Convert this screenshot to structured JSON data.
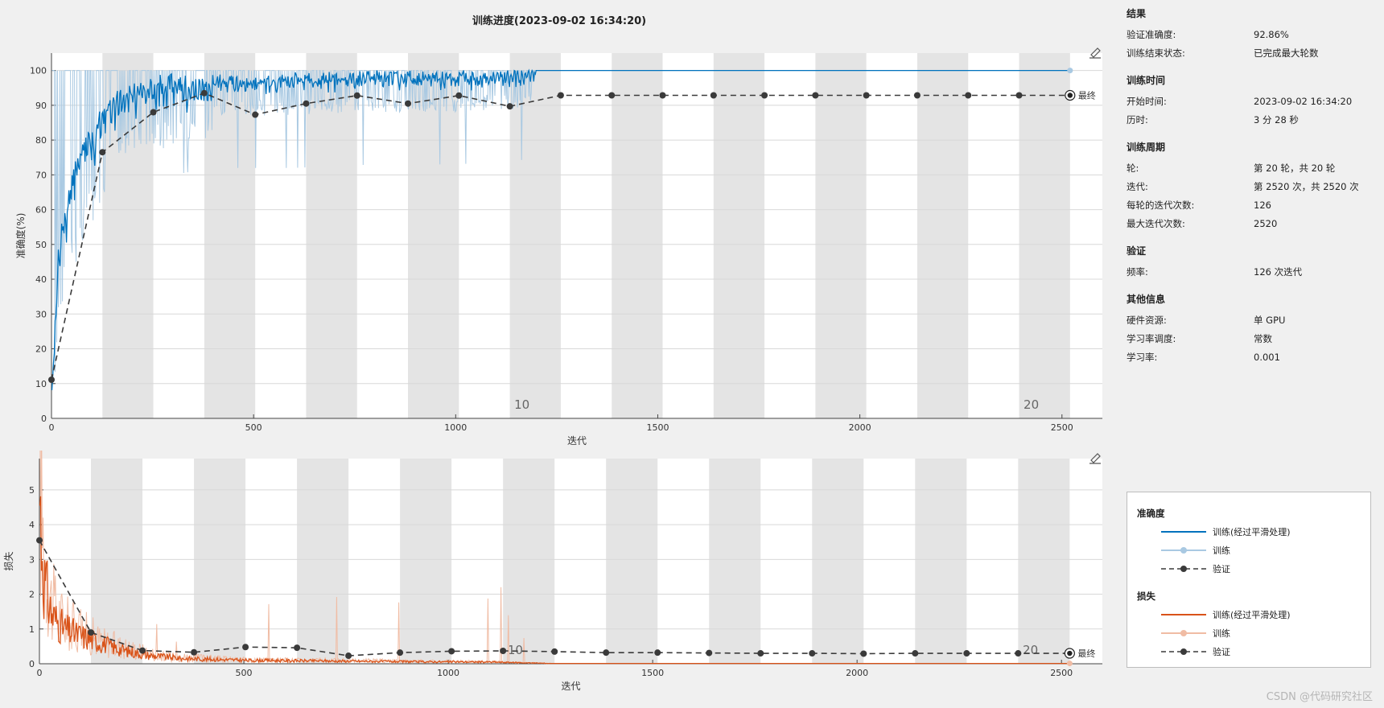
{
  "title": "训练进度(2023-09-02 16:34:20)",
  "info": {
    "sections": [
      {
        "title": "结果",
        "rows": [
          {
            "k": "验证准确度:",
            "v": "92.86%"
          },
          {
            "k": "训练结束状态:",
            "v": "已完成最大轮数"
          }
        ]
      },
      {
        "title": "训练时间",
        "rows": [
          {
            "k": "开始时间:",
            "v": "2023-09-02 16:34:20"
          },
          {
            "k": "历时:",
            "v": "3 分 28 秒"
          }
        ]
      },
      {
        "title": "训练周期",
        "rows": [
          {
            "k": "轮:",
            "v": "第 20 轮，共 20 轮"
          },
          {
            "k": "迭代:",
            "v": "第 2520 次，共 2520 次"
          },
          {
            "k": "每轮的迭代次数:",
            "v": "126"
          },
          {
            "k": "最大迭代次数:",
            "v": "2520"
          }
        ]
      },
      {
        "title": "验证",
        "rows": [
          {
            "k": "频率:",
            "v": "126 次迭代"
          }
        ]
      },
      {
        "title": "其他信息",
        "rows": [
          {
            "k": "硬件资源:",
            "v": "单 GPU"
          },
          {
            "k": "学习率调度:",
            "v": "常数"
          },
          {
            "k": "学习率:",
            "v": "0.001"
          }
        ]
      }
    ]
  },
  "legend": {
    "acc_title": "准确度",
    "loss_title": "损失",
    "smoothed": "训练(经过平滑处理)",
    "train": "训练",
    "val": "验证"
  },
  "final_label": "最终",
  "watermark": "CSDN @代码研究社区",
  "colors": {
    "acc_smooth": "#0072bd",
    "acc_raw": "#a9c9e2",
    "loss_smooth": "#d95319",
    "loss_raw": "#f0bca4",
    "val": "#3a3a3a",
    "band": "#e4e4e4"
  },
  "chart_data": [
    {
      "type": "line",
      "ylabel": "准确度(%)",
      "xlabel": "迭代",
      "xlim": [
        0,
        2600
      ],
      "ylim": [
        0,
        105
      ],
      "xticks": [
        0,
        500,
        1000,
        1500,
        2000,
        2500
      ],
      "yticks": [
        0,
        10,
        20,
        30,
        40,
        50,
        60,
        70,
        80,
        90,
        100
      ],
      "epoch_labels": [
        {
          "x": 1134,
          "label": "10"
        },
        {
          "x": 2394,
          "label": "20"
        }
      ],
      "iters_per_epoch": 126,
      "epochs": 20,
      "series": [
        {
          "name": "训练(经过平滑处理)",
          "x": [
            1,
            20,
            50,
            80,
            110,
            130,
            160,
            200,
            250,
            300,
            350,
            400,
            500,
            600,
            700,
            800,
            900,
            1000,
            1100,
            1150,
            1200,
            1300,
            1600,
            2000,
            2520
          ],
          "y": [
            10,
            55,
            70,
            80,
            85,
            90,
            93,
            95,
            97,
            98,
            97,
            98,
            97,
            98,
            98.5,
            99,
            98.5,
            99,
            99,
            99.5,
            100,
            100,
            100,
            100,
            100
          ]
        },
        {
          "name": "训练",
          "x": [
            1,
            20,
            50,
            80,
            110,
            130,
            200,
            300,
            400,
            500,
            600,
            800,
            1000,
            1150,
            1200,
            1500,
            2000,
            2520
          ],
          "y": [
            10,
            60,
            70,
            80,
            85,
            90,
            95,
            95,
            97,
            97,
            97,
            98,
            98,
            99,
            100,
            100,
            100,
            100
          ]
        },
        {
          "name": "验证",
          "x": [
            0,
            126,
            252,
            378,
            504,
            630,
            756,
            882,
            1008,
            1134,
            1260,
            1386,
            1512,
            1638,
            1764,
            1890,
            2016,
            2142,
            2268,
            2394,
            2520
          ],
          "y": [
            11.1,
            76.5,
            88,
            93.5,
            87.3,
            90.5,
            92.8,
            90.5,
            92.8,
            89.7,
            92.86,
            92.86,
            92.86,
            92.86,
            92.86,
            92.86,
            92.86,
            92.86,
            92.86,
            92.86,
            92.86
          ]
        }
      ]
    },
    {
      "type": "line",
      "ylabel": "损失",
      "xlabel": "迭代",
      "xlim": [
        0,
        2600
      ],
      "ylim": [
        0,
        5.9
      ],
      "xticks": [
        0,
        500,
        1000,
        1500,
        2000,
        2500
      ],
      "yticks": [
        0,
        1,
        2,
        3,
        4,
        5
      ],
      "epoch_labels": [
        {
          "x": 1134,
          "label": "10"
        },
        {
          "x": 2394,
          "label": "20"
        }
      ],
      "iters_per_epoch": 126,
      "epochs": 20,
      "series": [
        {
          "name": "训练(经过平滑处理)",
          "x": [
            1,
            10,
            30,
            60,
            100,
            150,
            200,
            260,
            350,
            500,
            700,
            900,
            1100,
            1250,
            1500,
            2000,
            2520
          ],
          "y": [
            4.8,
            2.5,
            1.4,
            1.0,
            0.8,
            0.6,
            0.4,
            0.25,
            0.15,
            0.1,
            0.08,
            0.06,
            0.05,
            0.01,
            0.01,
            0.01,
            0.01
          ]
        },
        {
          "name": "训练",
          "x": [
            1,
            10,
            30,
            60,
            100,
            150,
            200,
            300,
            500,
            800,
            1100,
            1250,
            2520
          ],
          "y": [
            5.2,
            3.0,
            1.6,
            1.1,
            0.9,
            0.6,
            0.45,
            0.2,
            0.1,
            0.08,
            0.05,
            0.01,
            0.01
          ]
        },
        {
          "name": "验证",
          "x": [
            0,
            126,
            252,
            378,
            504,
            630,
            756,
            882,
            1008,
            1134,
            1260,
            1386,
            1512,
            1638,
            1764,
            1890,
            2016,
            2142,
            2268,
            2394,
            2520
          ],
          "y": [
            3.55,
            0.9,
            0.38,
            0.33,
            0.48,
            0.46,
            0.23,
            0.32,
            0.36,
            0.37,
            0.35,
            0.32,
            0.32,
            0.31,
            0.3,
            0.3,
            0.29,
            0.3,
            0.3,
            0.3,
            0.3
          ]
        }
      ]
    }
  ]
}
